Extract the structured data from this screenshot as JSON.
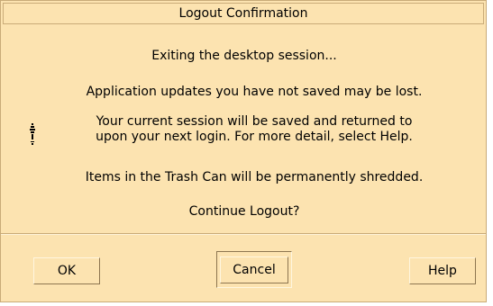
{
  "dialog": {
    "title": "Logout Confirmation",
    "messages": {
      "exiting": "Exiting the desktop session...",
      "unsaved": "Application updates you have not saved may be lost.",
      "session_line1": "Your current session will be saved and returned to",
      "session_line2": "upon your next login.  For more detail, select Help.",
      "trash": "Items in the Trash Can will be permanently shredded.",
      "question": "Continue Logout?"
    },
    "icon": "information-icon",
    "colors": {
      "background": "#fce3b0",
      "border": "#c9ab78"
    }
  },
  "buttons": {
    "ok": "OK",
    "cancel": "Cancel",
    "help": "Help"
  }
}
